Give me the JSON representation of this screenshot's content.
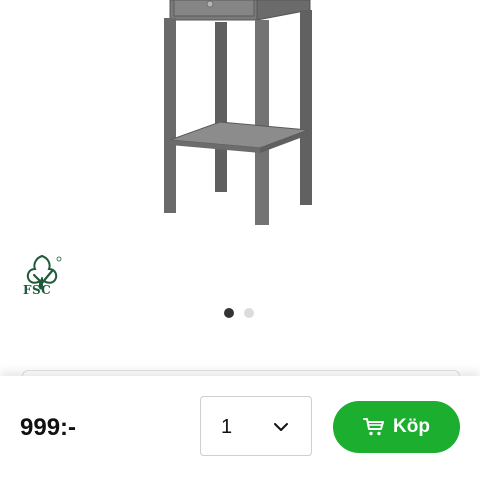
{
  "product": {
    "price": "999:-",
    "image_icon": "bedside-table-image"
  },
  "certification": {
    "label": "FSC",
    "icon": "fsc-tree-icon"
  },
  "carousel": {
    "total": 2,
    "active_index": 0
  },
  "purchase": {
    "quantity": "1",
    "buy_label": "Köp",
    "buy_icon": "cart-icon",
    "accent_color": "#1cae2e"
  }
}
